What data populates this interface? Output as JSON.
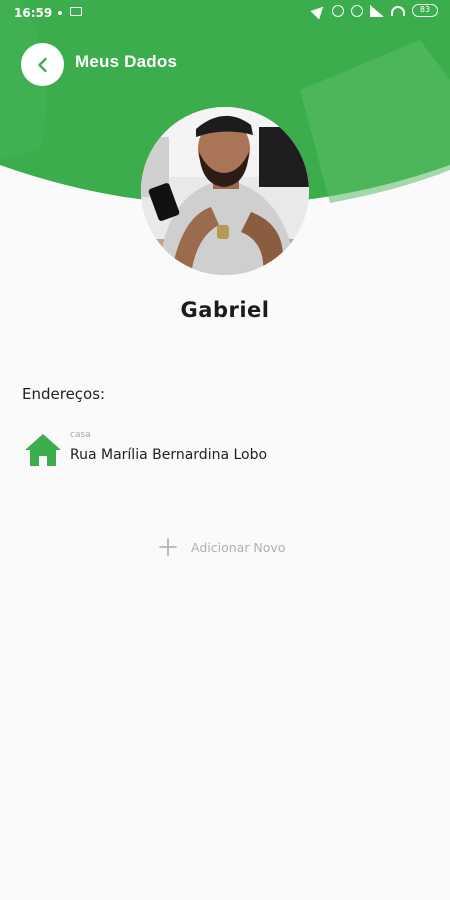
{
  "status_bar": {
    "time": "16:59",
    "battery": "83",
    "icons": [
      "dot-indicator",
      "monitor-icon",
      "navigation-icon",
      "sync-off-icon",
      "alarm-icon",
      "signal-icon",
      "wifi-icon",
      "battery-icon"
    ]
  },
  "header": {
    "title": "Meus Dados",
    "back_icon": "chevron-left-icon",
    "background_color": "#3cad4d"
  },
  "profile": {
    "name": "Gabriel",
    "avatar": "profile-photo"
  },
  "addresses": {
    "heading": "Endereços:",
    "items": [
      {
        "type": "casa",
        "street": "Rua Marília Bernardina Lobo",
        "icon": "home-icon"
      }
    ]
  },
  "add_new": {
    "label": "Adicionar Novo",
    "icon": "plus-icon"
  },
  "colors": {
    "accent": "#3cad4d",
    "accent_light": "#5bbd68",
    "background": "#fafafa"
  }
}
